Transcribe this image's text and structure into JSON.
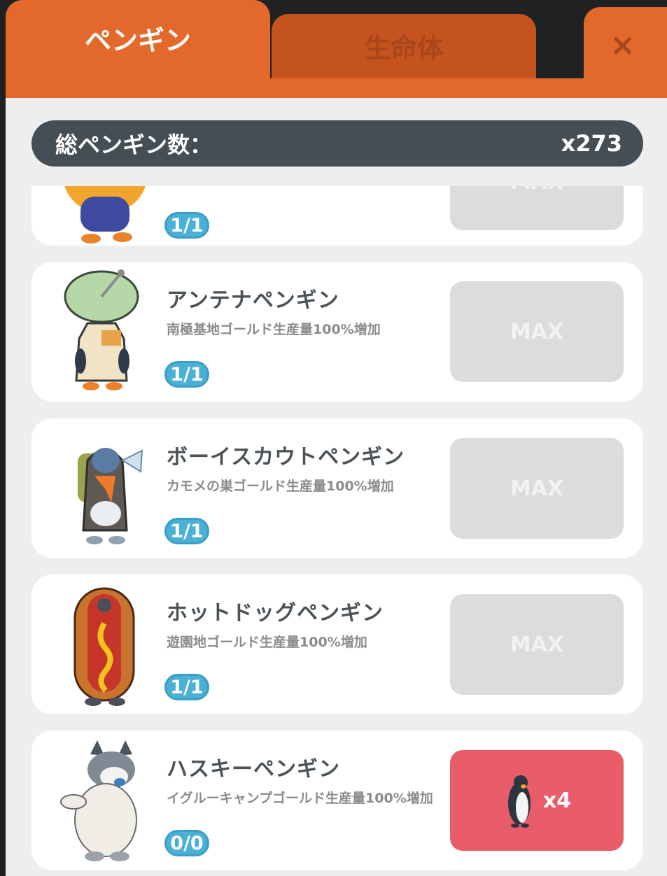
{
  "tabs": [
    {
      "label": "ペンギン",
      "active": true
    },
    {
      "label": "生命体",
      "active": false
    }
  ],
  "close_label": "×",
  "total": {
    "label": "総ペンギン数：",
    "value": "x273"
  },
  "items": [
    {
      "name": "",
      "desc": "",
      "count": "1/1",
      "button": "MAX",
      "avatar": "penguin-partial-icon"
    },
    {
      "name": "アンテナペンギン",
      "desc": "南極基地ゴールド生産量100%増加",
      "count": "1/1",
      "button": "MAX",
      "avatar": "antenna-penguin-icon"
    },
    {
      "name": "ボーイスカウトペンギン",
      "desc": "カモメの巣ゴールド生産量100%増加",
      "count": "1/1",
      "button": "MAX",
      "avatar": "boyscout-penguin-icon"
    },
    {
      "name": "ホットドッグペンギン",
      "desc": "遊園地ゴールド生産量100%増加",
      "count": "1/1",
      "button": "MAX",
      "avatar": "hotdog-penguin-icon"
    },
    {
      "name": "ハスキーペンギン",
      "desc": "イグルーキャンプゴールド生産量100%増加",
      "count": "0/0",
      "button": "x4",
      "avatar": "husky-penguin-icon"
    }
  ],
  "colors": {
    "tab": "#e2692b",
    "tab_inactive": "#c5531f",
    "buy": "#e95c6a",
    "badge": "#4ab0d6",
    "bar": "#444e54"
  }
}
